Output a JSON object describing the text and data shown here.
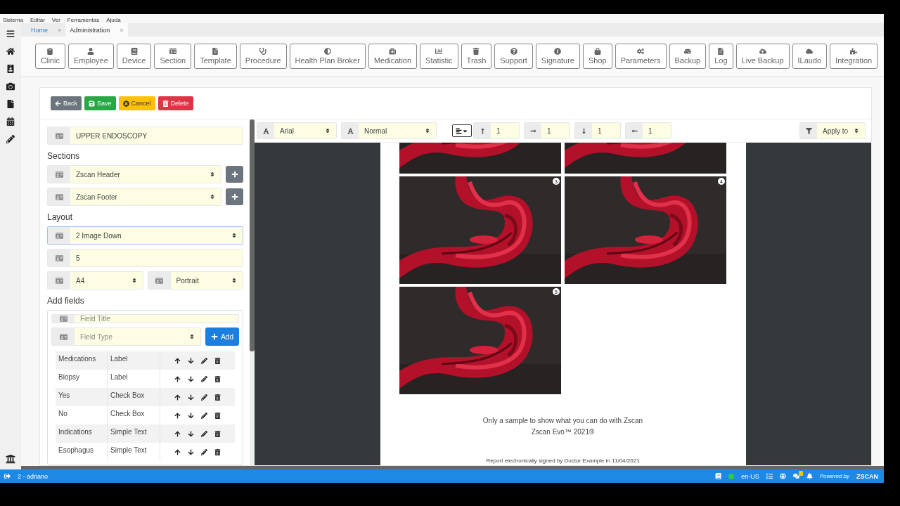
{
  "menu": [
    "Sistema",
    "Editar",
    "Ver",
    "Ferramentas",
    "Ajuda"
  ],
  "tabs": [
    {
      "label": "Home",
      "selected": false,
      "close": "×"
    },
    {
      "label": "Administration",
      "selected": true,
      "close": "×"
    }
  ],
  "toolbar": [
    "Clinic",
    "Employee",
    "Device",
    "Section",
    "Template",
    "Procedure",
    "Health Plan Broker",
    "Medication",
    "Statistic",
    "Trash",
    "Support",
    "Signature",
    "Shop",
    "Parameters",
    "Backup",
    "Log",
    "Live Backup",
    "ILaudo",
    "Integration"
  ],
  "actions": [
    {
      "label": "Back",
      "kind": "back"
    },
    {
      "label": "Save",
      "kind": "save"
    },
    {
      "label": "Cancel",
      "kind": "cancel"
    },
    {
      "label": "Delete",
      "kind": "delete"
    }
  ],
  "form": {
    "title_value": "UPPER ENDOSCOPY",
    "sections_heading": "Sections",
    "sections": [
      "Zscan Header",
      "Zscan Footer"
    ],
    "layout_heading": "Layout",
    "layout_value": "2 Image Down",
    "count_value": "5",
    "paper_value": "A4",
    "orientation_value": "Portrait",
    "add_fields_heading": "Add fields",
    "field_title_placeholder": "Field Title",
    "field_type_placeholder": "Field Type",
    "add_label": "Add",
    "fields": [
      {
        "name": "Medications",
        "type": "Label"
      },
      {
        "name": "Biopsy",
        "type": "Label"
      },
      {
        "name": "Yes",
        "type": "Check Box"
      },
      {
        "name": "No",
        "type": "Check Box"
      },
      {
        "name": "Indications",
        "type": "Simple Text"
      },
      {
        "name": "Esophagus",
        "type": "Simple Text"
      }
    ]
  },
  "format_bar": {
    "font": "Arial",
    "size": "Normal",
    "spacings": [
      "1",
      "1",
      "1",
      "1"
    ],
    "apply": "Apply to"
  },
  "preview": {
    "images": [
      {
        "kind": "picture"
      },
      {
        "kind": "picture"
      },
      {
        "kind": "picture",
        "number": "3"
      },
      {
        "kind": "picture",
        "number": "4"
      },
      {
        "kind": "picture",
        "number": "5"
      }
    ],
    "footer_lines": [
      "Only a sample to show what you can do with Zscan",
      "Zscan Evo™ 2021®"
    ],
    "signature": "Report electronically signed by Doctor Example in 11/04/2021"
  },
  "status_bar": {
    "user": "2 - adriano",
    "language": "en-US",
    "powered_by": "Powered by",
    "brand": "ZSCAN"
  }
}
